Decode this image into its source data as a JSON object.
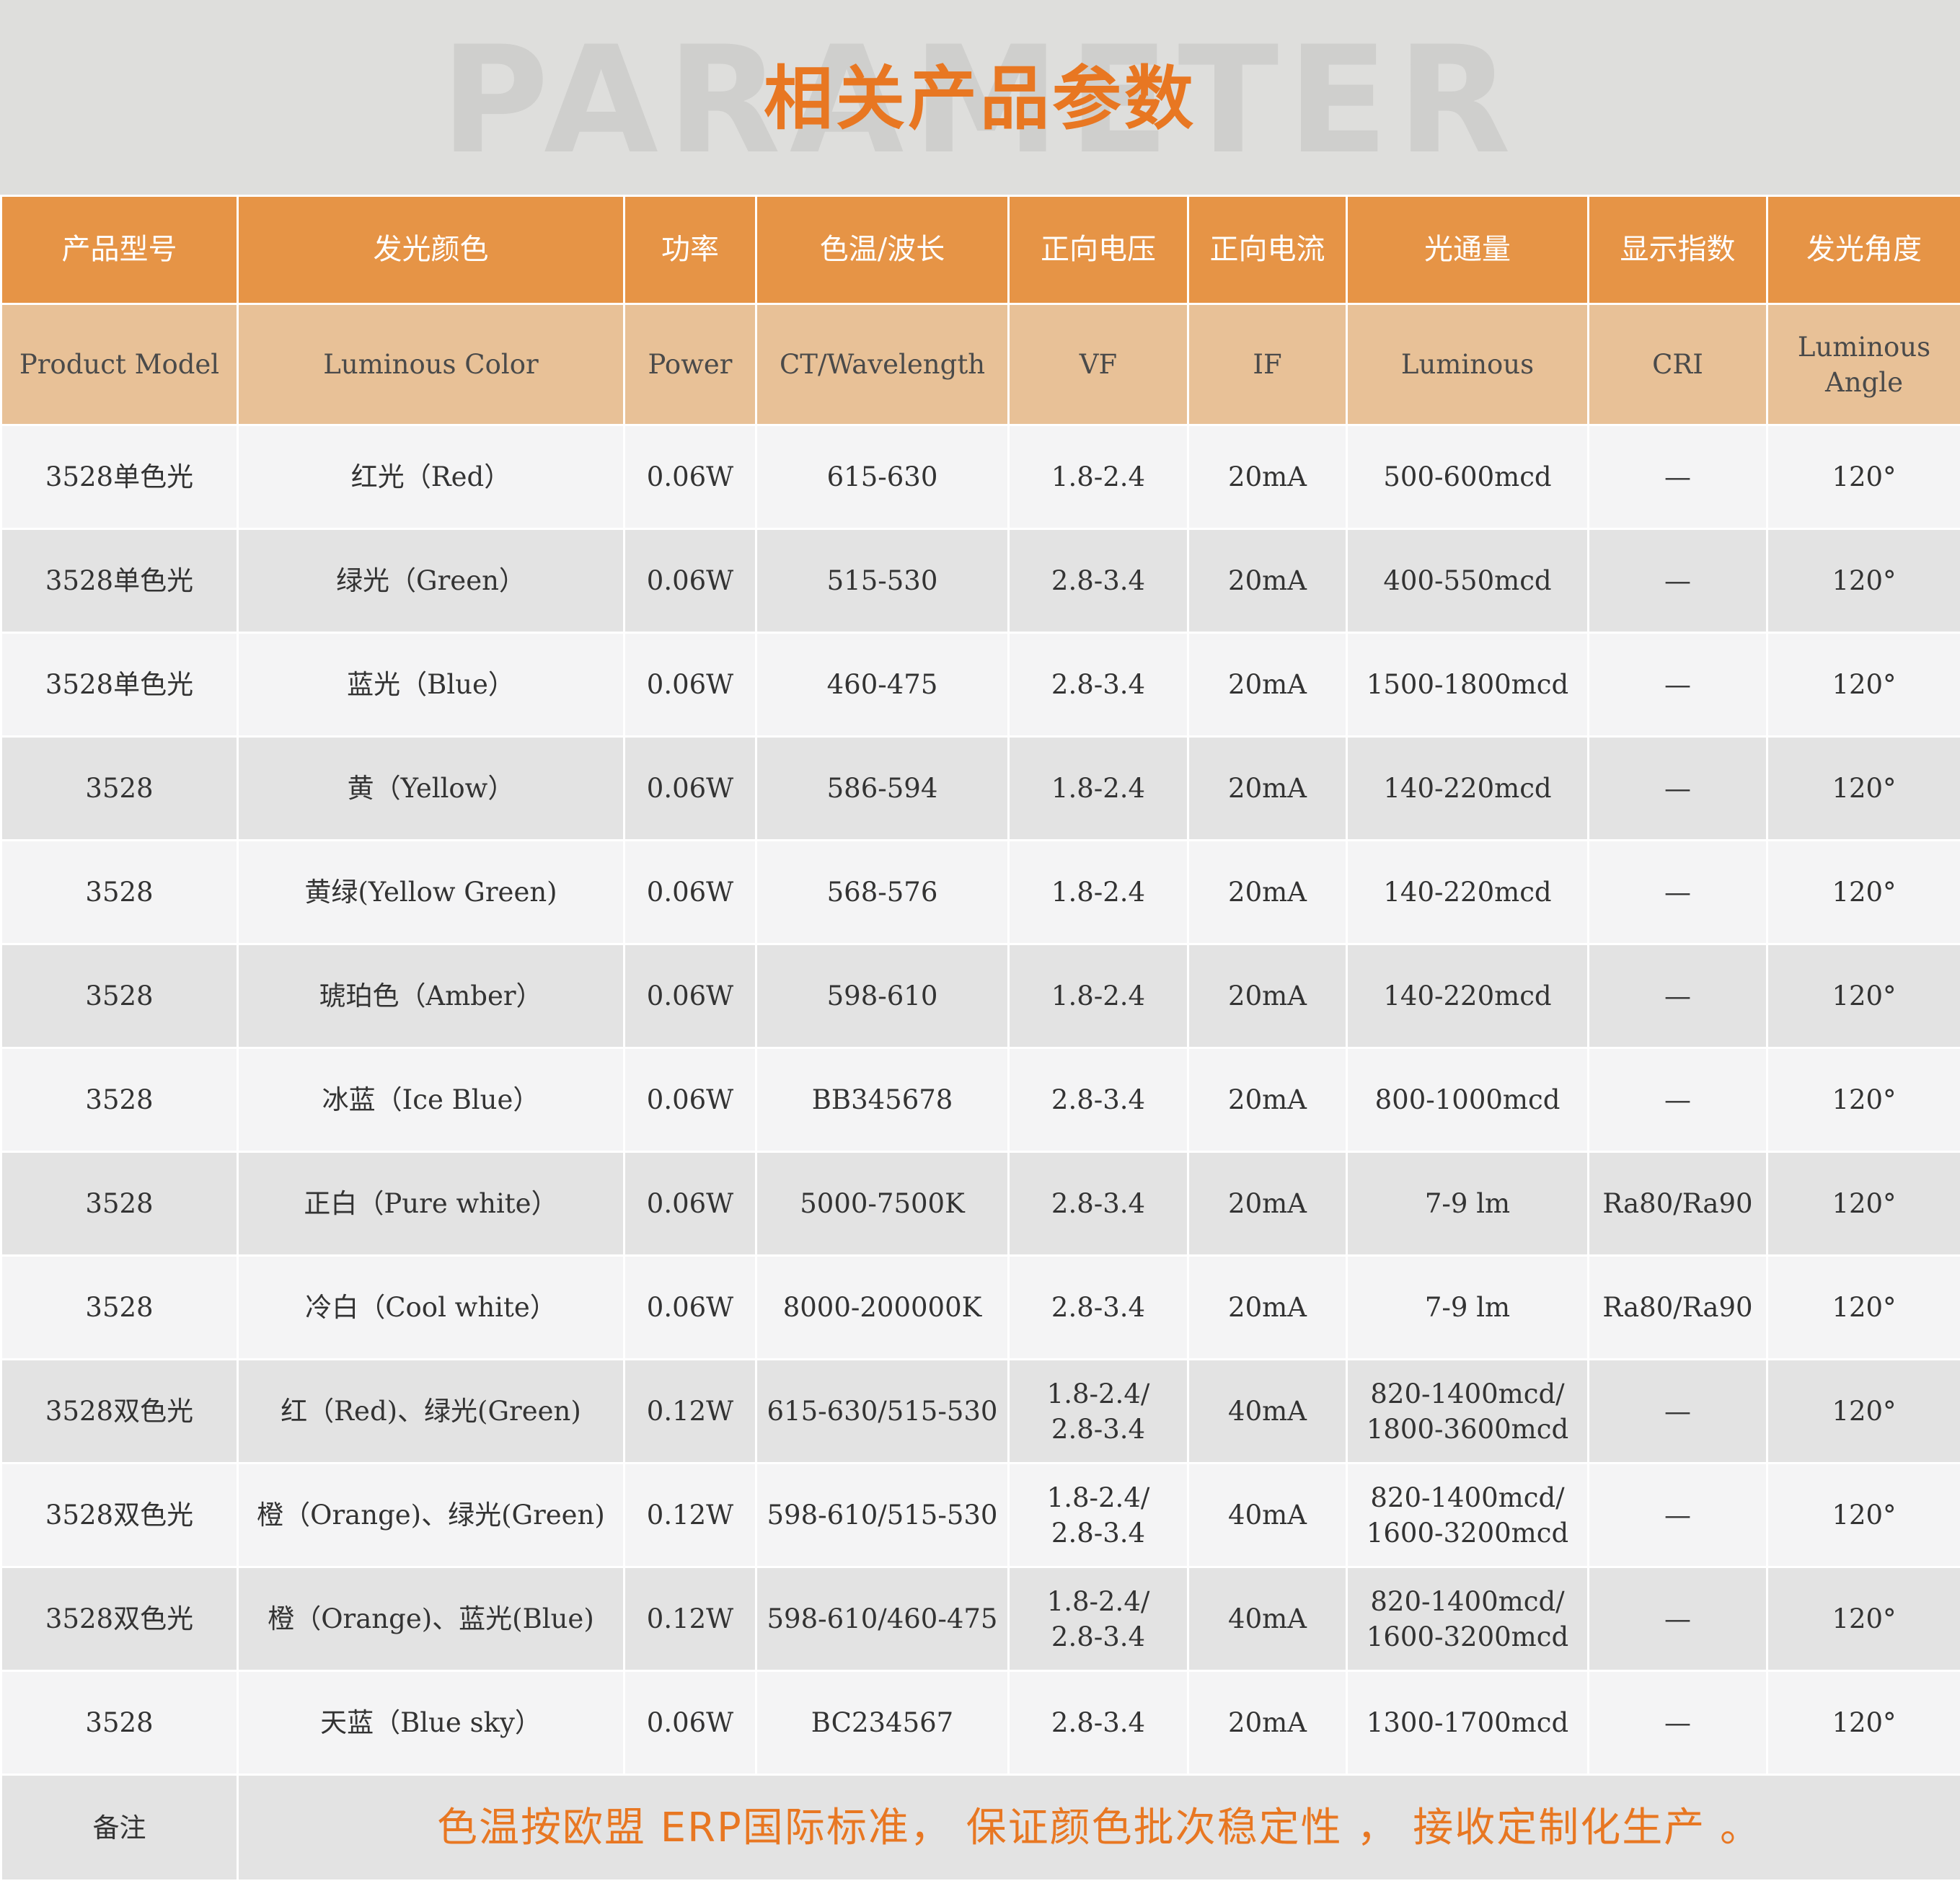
{
  "watermark": "PARAMETER",
  "title": "相关产品参数",
  "columns_cn": [
    "产品型号",
    "发光颜色",
    "功率",
    "色温/波长",
    "正向电压",
    "正向电流",
    "光通量",
    "显示指数",
    "发光角度"
  ],
  "columns_en": [
    "Product Model",
    "Luminous Color",
    "Power",
    "CT/Wavelength",
    "VF",
    "IF",
    "Luminous",
    "CRI",
    [
      "Luminous",
      "Angle"
    ]
  ],
  "rows": [
    [
      "3528单色光",
      "红光（Red）",
      "0.06W",
      "615-630",
      "1.8-2.4",
      "20mA",
      "500-600mcd",
      "—",
      "120°"
    ],
    [
      "3528单色光",
      "绿光（Green）",
      "0.06W",
      "515-530",
      "2.8-3.4",
      "20mA",
      "400-550mcd",
      "—",
      "120°"
    ],
    [
      "3528单色光",
      "蓝光（Blue）",
      "0.06W",
      "460-475",
      "2.8-3.4",
      "20mA",
      "1500-1800mcd",
      "—",
      "120°"
    ],
    [
      "3528",
      "黄（Yellow）",
      "0.06W",
      "586-594",
      "1.8-2.4",
      "20mA",
      "140-220mcd",
      "—",
      "120°"
    ],
    [
      "3528",
      "黄绿(Yellow Green)",
      "0.06W",
      "568-576",
      "1.8-2.4",
      "20mA",
      "140-220mcd",
      "—",
      "120°"
    ],
    [
      "3528",
      "琥珀色（Amber）",
      "0.06W",
      "598-610",
      "1.8-2.4",
      "20mA",
      "140-220mcd",
      "—",
      "120°"
    ],
    [
      "3528",
      "冰蓝（Ice Blue）",
      "0.06W",
      "BB345678",
      "2.8-3.4",
      "20mA",
      "800-1000mcd",
      "—",
      "120°"
    ],
    [
      "3528",
      "正白（Pure white）",
      "0.06W",
      "5000-7500K",
      "2.8-3.4",
      "20mA",
      "7-9 lm",
      "Ra80/Ra90",
      "120°"
    ],
    [
      "3528",
      "冷白（Cool white）",
      "0.06W",
      "8000-200000K",
      "2.8-3.4",
      "20mA",
      "7-9 lm",
      "Ra80/Ra90",
      "120°"
    ],
    [
      "3528双色光",
      "红（Red)、绿光(Green)",
      "0.12W",
      "615-630/515-530",
      [
        "1.8-2.4/",
        "2.8-3.4"
      ],
      "40mA",
      [
        "820-1400mcd/",
        "1800-3600mcd"
      ],
      "—",
      "120°"
    ],
    [
      "3528双色光",
      "橙（Orange)、绿光(Green)",
      "0.12W",
      "598-610/515-530",
      [
        "1.8-2.4/",
        "2.8-3.4"
      ],
      "40mA",
      [
        "820-1400mcd/",
        "1600-3200mcd"
      ],
      "—",
      "120°"
    ],
    [
      "3528双色光",
      "橙（Orange)、蓝光(Blue)",
      "0.12W",
      "598-610/460-475",
      [
        "1.8-2.4/",
        "2.8-3.4"
      ],
      "40mA",
      [
        "820-1400mcd/",
        "1600-3200mcd"
      ],
      "—",
      "120°"
    ],
    [
      "3528",
      "天蓝（Blue sky）",
      "0.06W",
      "BC234567",
      "2.8-3.4",
      "20mA",
      "1300-1700mcd",
      "—",
      "120°"
    ]
  ],
  "note": {
    "label": "备注",
    "text": "色温按欧盟 ERP国际标准， 保证颜色批次稳定性 ， 接收定制化生产 。"
  },
  "colors": {
    "accent": "#e87722",
    "header_dark": "#e69446",
    "header_light": "#e8c197",
    "row_light": "#f4f4f5",
    "row_dark": "#e3e3e3"
  }
}
